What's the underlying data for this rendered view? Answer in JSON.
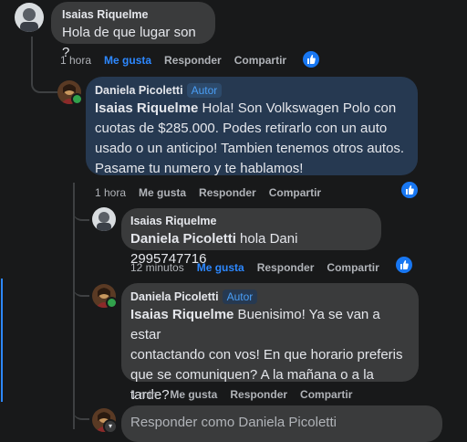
{
  "comments": [
    {
      "author": "Isaias Riquelme",
      "text": "Hola de que lugar son ?",
      "time": "1 hora",
      "like_label": "Me gusta",
      "reply_label": "Responder",
      "share_label": "Compartir",
      "liked": true
    },
    {
      "author": "Daniela Picoletti",
      "badge": "Autor",
      "mention": "Isaias Riquelme",
      "text_lines": [
        " Hola! Son Volkswagen Polo con",
        "cuotas de $285.000. Podes retirarlo con un auto",
        "usado o un anticipo! Tambien tenemos otros autos.",
        "Pasame tu numero y te hablamos!"
      ],
      "time": "1 hora",
      "like_label": "Me gusta",
      "reply_label": "Responder",
      "share_label": "Compartir"
    },
    {
      "author": "Isaias Riquelme",
      "mention": "Daniela Picoletti",
      "text": " hola Dani 2995747716",
      "time": "12 minutos",
      "like_label": "Me gusta",
      "reply_label": "Responder",
      "share_label": "Compartir",
      "liked": true
    },
    {
      "author": "Daniela Picoletti",
      "badge": "Autor",
      "mention": "Isaias Riquelme",
      "text_lines": [
        " Buenisimo! Ya se van a estar",
        "contactando con vos! En que horario preferis",
        "que se comuniquen? A la mañana o a la",
        "tarde?"
      ],
      "time": "1 min",
      "like_label": "Me gusta",
      "reply_label": "Responder",
      "share_label": "Compartir"
    }
  ],
  "reply_box": {
    "placeholder": "Responder como Daniela Picoletti"
  },
  "colors": {
    "background": "#18191a",
    "bubble": "#3a3b3c",
    "highlight_bubble": "#263951",
    "link_blue": "#2d88ff",
    "muted": "#b0b3b8"
  }
}
